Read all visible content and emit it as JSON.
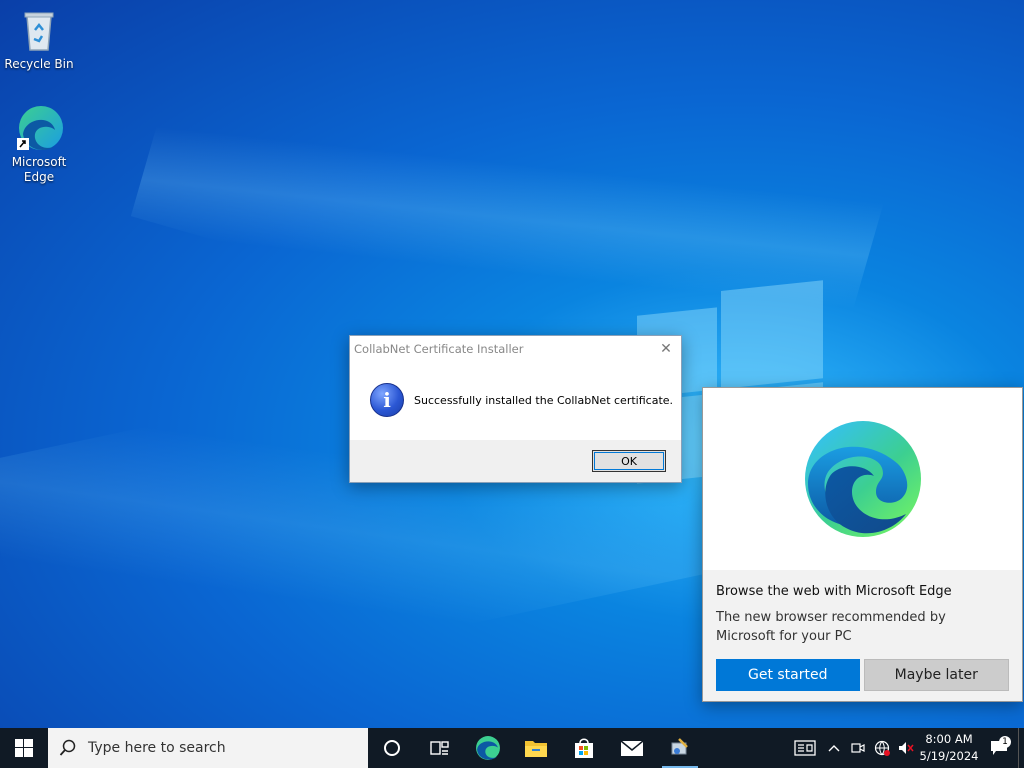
{
  "desktop": {
    "icons": [
      {
        "label": "Recycle Bin",
        "icon": "recycle-bin-icon"
      },
      {
        "label": "Microsoft Edge",
        "icon": "edge-icon"
      }
    ]
  },
  "dialog": {
    "title": "CollabNet Certificate Installer",
    "message": "Successfully installed the CollabNet certificate.",
    "ok_label": "OK",
    "close_glyph": "✕",
    "icon": "info-icon"
  },
  "promo": {
    "headline": "Browse the web with Microsoft Edge",
    "subtext": "The new browser recommended by Microsoft for your PC",
    "primary_label": "Get started",
    "secondary_label": "Maybe later",
    "primary_color": "#0078d7"
  },
  "taskbar": {
    "search_placeholder": "Type here to search",
    "apps": [
      "cortana-icon",
      "task-view-icon",
      "edge-icon",
      "file-explorer-icon",
      "store-icon",
      "mail-icon",
      "installer-icon"
    ],
    "time": "8:00 AM",
    "date": "5/19/2024",
    "notification_count": "1"
  }
}
